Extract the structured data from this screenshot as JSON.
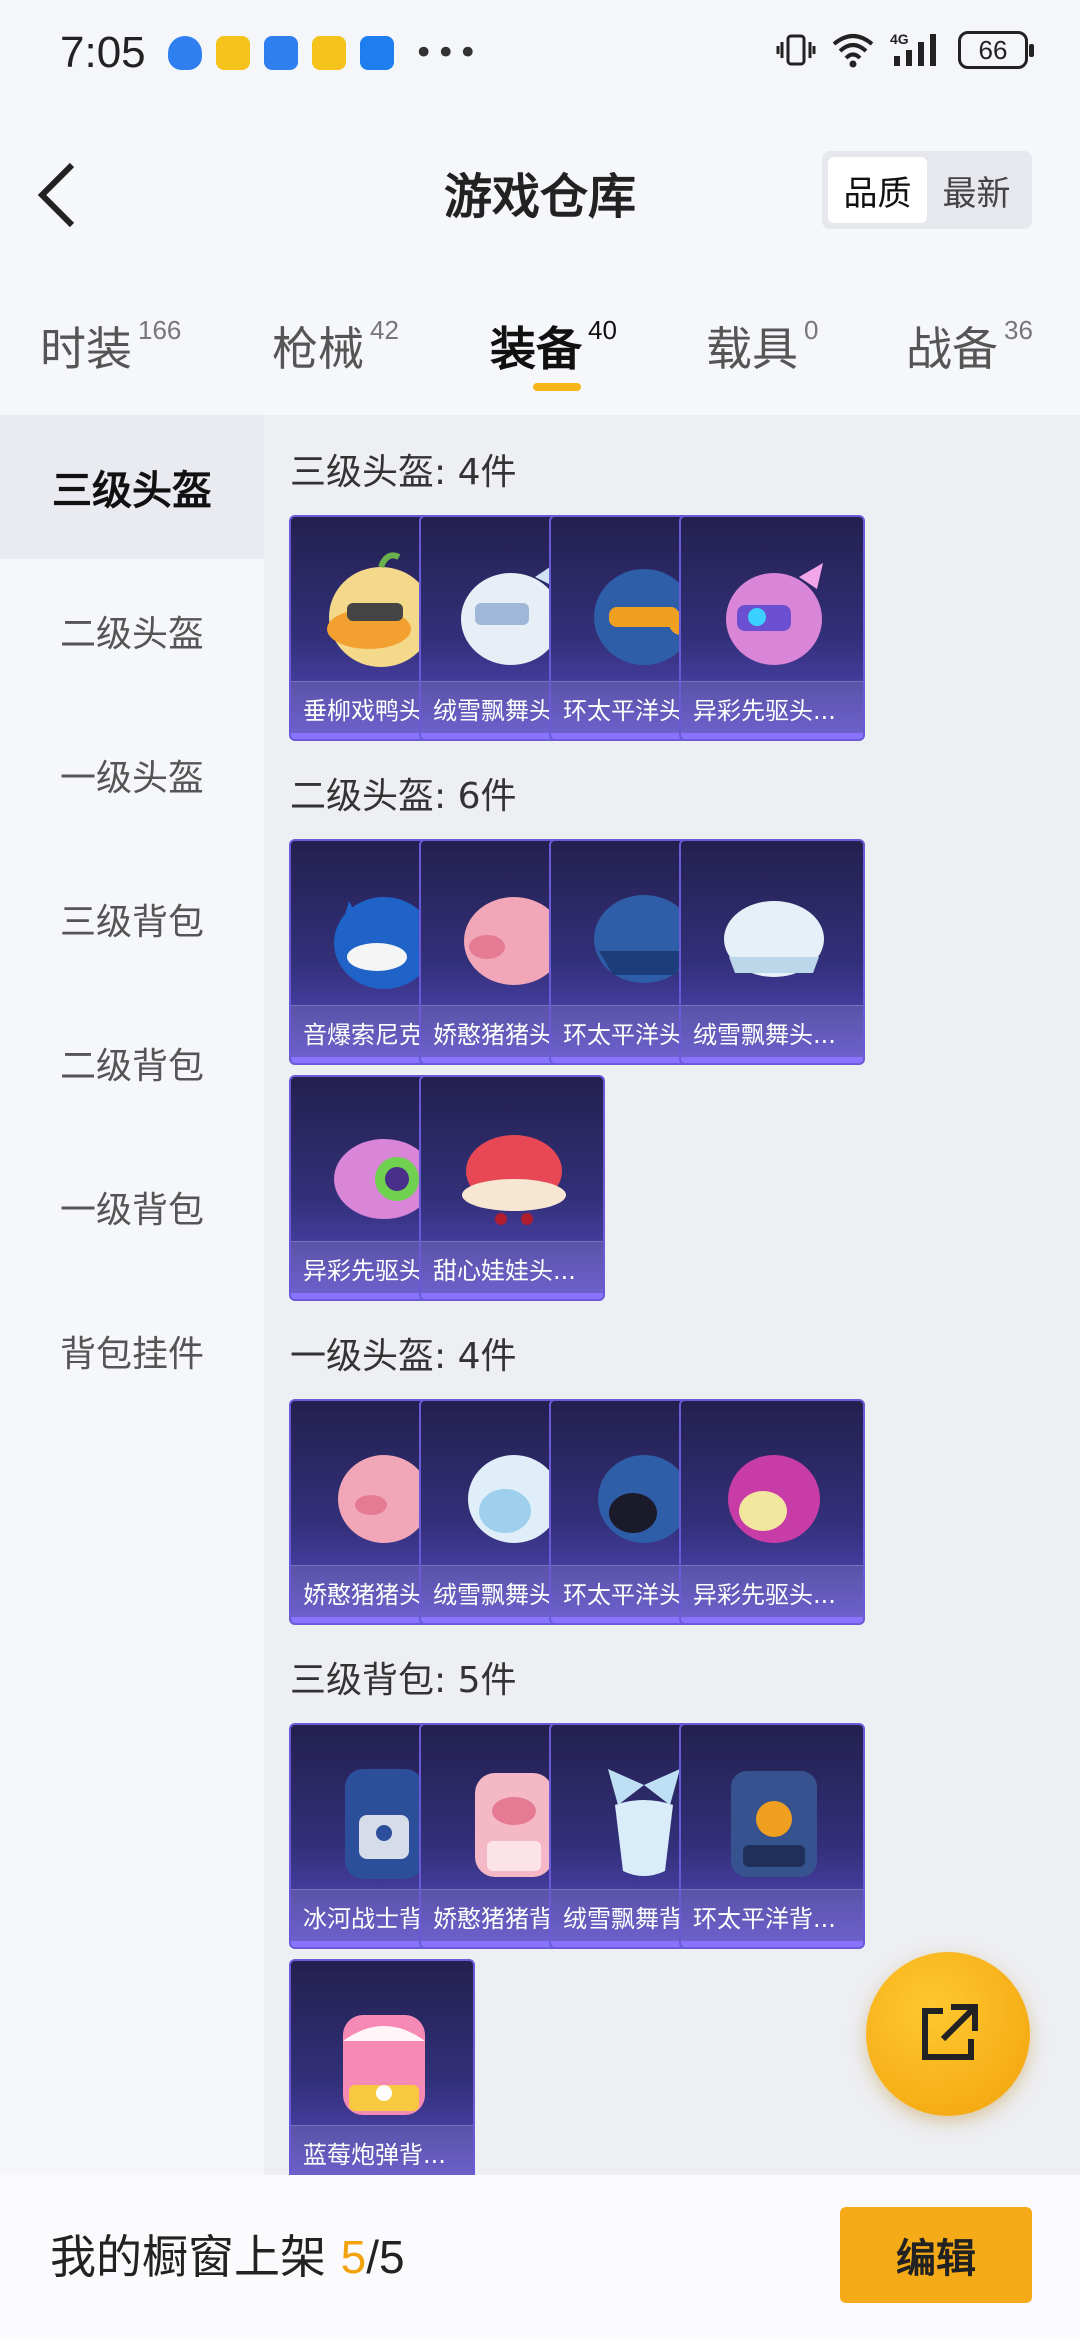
{
  "status": {
    "time": "7:05",
    "battery": "66",
    "network": "4G"
  },
  "header": {
    "title": "游戏仓库",
    "sort_options": [
      "品质",
      "最新"
    ]
  },
  "tabs": [
    {
      "label": "时装",
      "count": "166"
    },
    {
      "label": "枪械",
      "count": "42"
    },
    {
      "label": "装备",
      "count": "40"
    },
    {
      "label": "载具",
      "count": "0"
    },
    {
      "label": "战备",
      "count": "36"
    }
  ],
  "sidebar": {
    "items": [
      "三级头盔",
      "二级头盔",
      "一级头盔",
      "三级背包",
      "二级背包",
      "一级背包",
      "背包挂件"
    ]
  },
  "sections": [
    {
      "title": "三级头盔: 4件",
      "items": [
        "垂柳戏鸭头...",
        "绒雪飘舞头...",
        "环太平洋头...",
        "异彩先驱头..."
      ]
    },
    {
      "title": "二级头盔: 6件",
      "items": [
        "音爆索尼克...",
        "娇憨猪猪头...",
        "环太平洋头...",
        "绒雪飘舞头...",
        "异彩先驱头...",
        "甜心娃娃头..."
      ]
    },
    {
      "title": "一级头盔: 4件",
      "items": [
        "娇憨猪猪头...",
        "绒雪飘舞头...",
        "环太平洋头...",
        "异彩先驱头..."
      ]
    },
    {
      "title": "三级背包: 5件",
      "items": [
        "冰河战士背...",
        "娇憨猪猪背...",
        "绒雪飘舞背...",
        "环太平洋背...",
        "蓝莓炮弹背..."
      ]
    }
  ],
  "bottom": {
    "text": "我的橱窗上架",
    "current": "5",
    "total": "/5",
    "edit_label": "编辑"
  },
  "colors": {
    "accent": "#f5aa18",
    "card_top": "#23204f",
    "card_bottom": "#5b4cc9"
  }
}
